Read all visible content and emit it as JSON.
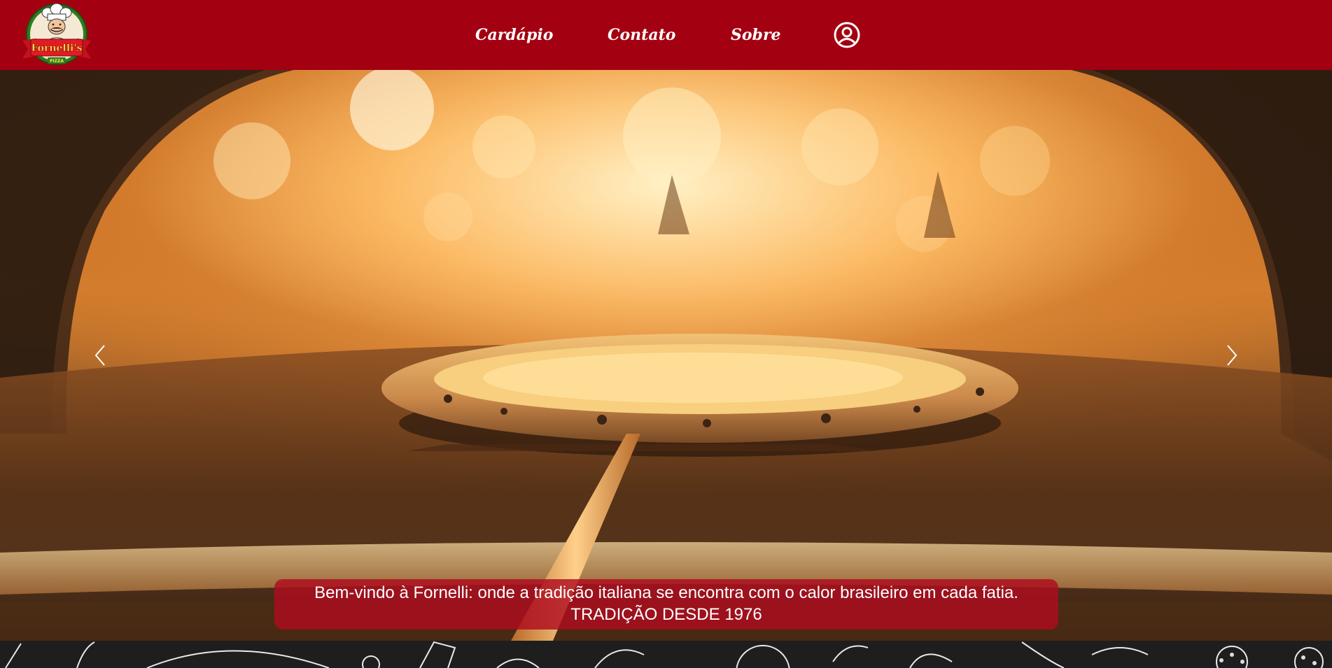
{
  "header": {
    "logo": {
      "brand_text": "Fornelli's",
      "sub_text": "PIZZA",
      "icon": "chef-logo-icon"
    },
    "nav": [
      {
        "label": "Cardápio"
      },
      {
        "label": "Contato"
      },
      {
        "label": "Sobre"
      }
    ],
    "user_icon": "user-circle-icon"
  },
  "hero": {
    "image_icon": "pizza-oven-photo",
    "prev_icon": "chevron-left-icon",
    "next_icon": "chevron-right-icon",
    "caption": {
      "line1": "Bem-vindo à Fornelli: onde a tradição italiana se encontra com o calor brasileiro em cada fatia.",
      "line2": "TRADIÇÃO DESDE 1976"
    }
  },
  "colors": {
    "brand_red": "#a30011",
    "caption_bg": "#af0c1e",
    "footer_bg": "#1e1e1e"
  }
}
